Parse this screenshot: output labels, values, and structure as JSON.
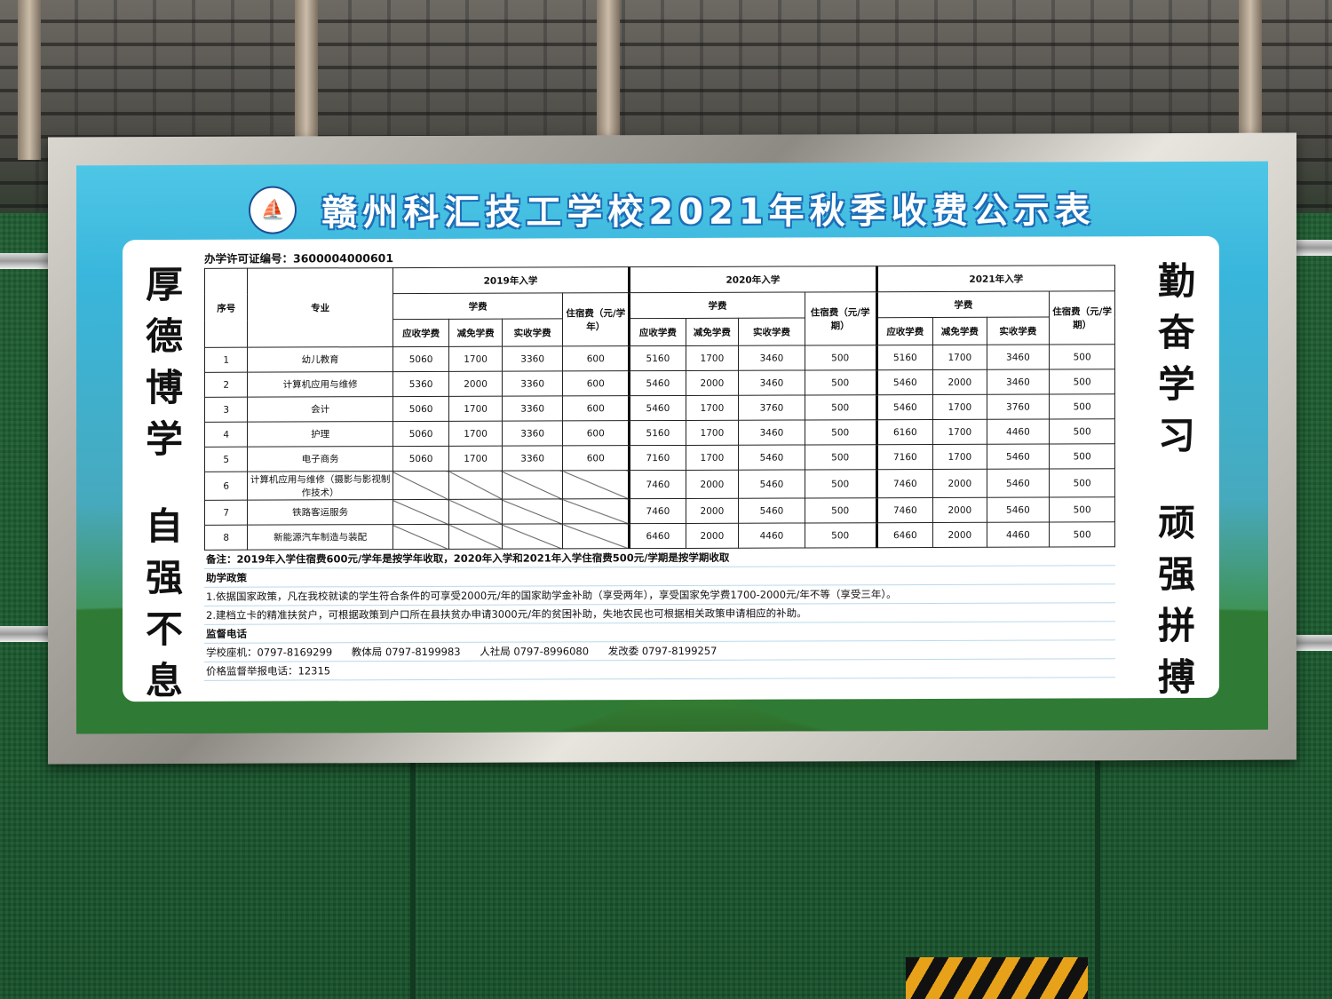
{
  "board": {
    "title": "赣州科汇技工学校2021年秋季收费公示表",
    "license": "办学许可证编号：3600004000601",
    "motto_left": [
      "厚",
      "德",
      "博",
      "学",
      "自",
      "强",
      "不",
      "息"
    ],
    "motto_right": [
      "勤",
      "奋",
      "学",
      "习",
      "顽",
      "强",
      "拼",
      "搏"
    ]
  },
  "table": {
    "col_index": "序号",
    "col_major": "专业",
    "year_groups": [
      "2019年入学",
      "2020年入学",
      "2021年入学"
    ],
    "tuition_label": "学费",
    "dorm_labels": [
      "住宿费（元/学年）",
      "住宿费（元/学期）",
      "住宿费（元/学期）"
    ],
    "fee_cols": [
      "应收学费",
      "减免学费",
      "实收学费"
    ],
    "rows": [
      {
        "no": "1",
        "major": "幼儿教育",
        "y2019": [
          "5060",
          "1700",
          "3360",
          "600"
        ],
        "y2020": [
          "5160",
          "1700",
          "3460",
          "500"
        ],
        "y2021": [
          "5160",
          "1700",
          "3460",
          "500"
        ]
      },
      {
        "no": "2",
        "major": "计算机应用与维修",
        "y2019": [
          "5360",
          "2000",
          "3360",
          "600"
        ],
        "y2020": [
          "5460",
          "2000",
          "3460",
          "500"
        ],
        "y2021": [
          "5460",
          "2000",
          "3460",
          "500"
        ]
      },
      {
        "no": "3",
        "major": "会计",
        "y2019": [
          "5060",
          "1700",
          "3360",
          "600"
        ],
        "y2020": [
          "5460",
          "1700",
          "3760",
          "500"
        ],
        "y2021": [
          "5460",
          "1700",
          "3760",
          "500"
        ]
      },
      {
        "no": "4",
        "major": "护理",
        "y2019": [
          "5060",
          "1700",
          "3360",
          "600"
        ],
        "y2020": [
          "5160",
          "1700",
          "3460",
          "500"
        ],
        "y2021": [
          "6160",
          "1700",
          "4460",
          "500"
        ]
      },
      {
        "no": "5",
        "major": "电子商务",
        "y2019": [
          "5060",
          "1700",
          "3360",
          "600"
        ],
        "y2020": [
          "7160",
          "1700",
          "5460",
          "500"
        ],
        "y2021": [
          "7160",
          "1700",
          "5460",
          "500"
        ]
      },
      {
        "no": "6",
        "major": "计算机应用与维修（摄影与影视制作技术）",
        "y2019": null,
        "y2020": [
          "7460",
          "2000",
          "5460",
          "500"
        ],
        "y2021": [
          "7460",
          "2000",
          "5460",
          "500"
        ]
      },
      {
        "no": "7",
        "major": "铁路客运服务",
        "y2019": null,
        "y2020": [
          "7460",
          "2000",
          "5460",
          "500"
        ],
        "y2021": [
          "7460",
          "2000",
          "5460",
          "500"
        ]
      },
      {
        "no": "8",
        "major": "新能源汽车制造与装配",
        "y2019": null,
        "y2020": [
          "6460",
          "2000",
          "4460",
          "500"
        ],
        "y2021": [
          "6460",
          "2000",
          "4460",
          "500"
        ]
      }
    ]
  },
  "notes": {
    "remark": "备注：2019年入学住宿费600元/学年是按学年收取，2020年入学和2021年入学住宿费500元/学期是按学期收取",
    "policy_title": "助学政策",
    "policy_1": "1.依据国家政策，凡在我校就读的学生符合条件的可享受2000元/年的国家助学金补助（享受两年），享受国家免学费1700-2000元/年不等（享受三年）。",
    "policy_2": "2.建档立卡的精准扶贫户，可根据政策到户口所在县扶贫办申请3000元/年的贫困补助，失地农民也可根据相关政策申请相应的补助。",
    "phone_title": "监督电话",
    "phones": [
      "学校座机：0797-8169299",
      "教体局 0797-8199983",
      "人社局 0797-8996080",
      "发改委 0797-8199257"
    ],
    "price_hotline": "价格监督举报电话：12315"
  }
}
